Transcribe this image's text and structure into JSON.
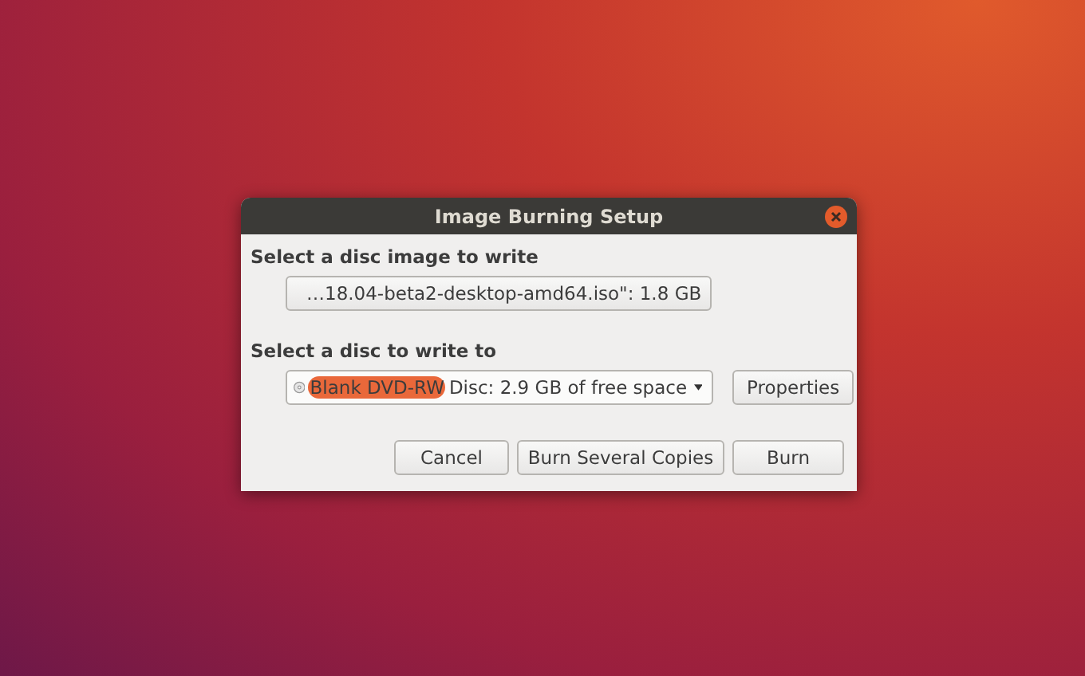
{
  "window": {
    "title": "Image Burning Setup"
  },
  "image_section": {
    "label": "Select a disc image to write",
    "file_button": "…18.04-beta2-desktop-amd64.iso\": 1.8 GB"
  },
  "disc_section": {
    "label": "Select a disc to write to",
    "disc_combo": {
      "highlighted": "Blank DVD-RW",
      "text": "Disc: 2.9 GB of free space"
    },
    "properties_button": "Properties"
  },
  "buttons": [
    "Cancel",
    "Burn Several Copies",
    "Burn"
  ]
}
